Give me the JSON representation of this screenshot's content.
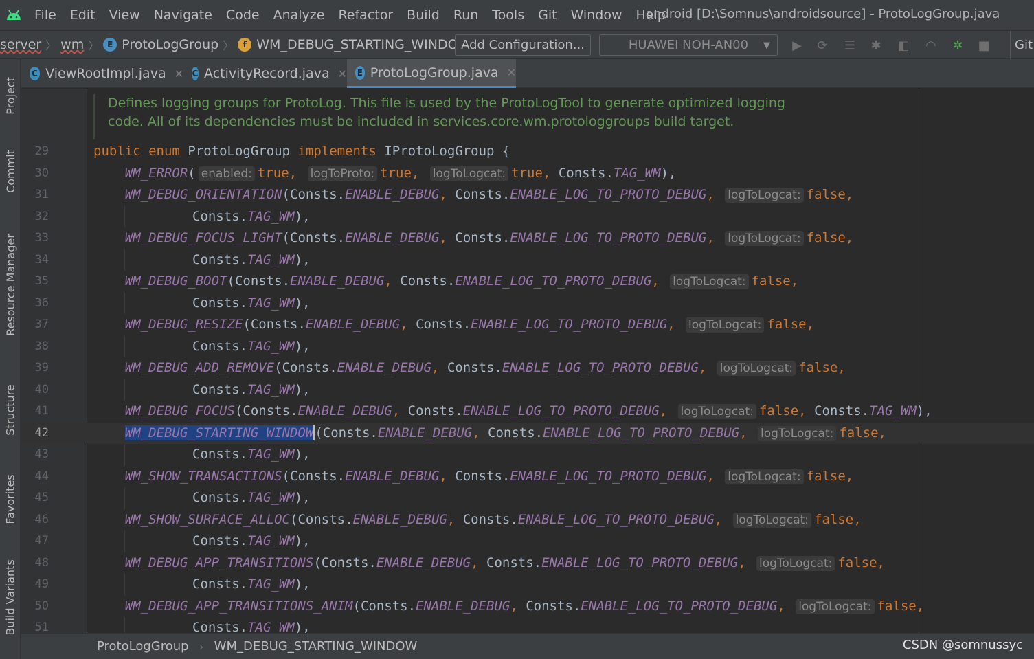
{
  "menubar": {
    "items": [
      "File",
      "Edit",
      "View",
      "Navigate",
      "Code",
      "Analyze",
      "Refactor",
      "Build",
      "Run",
      "Tools",
      "Git",
      "Window",
      "Help"
    ],
    "window_title": "android [D:\\Somnus\\androidsource] - ProtoLogGroup.java"
  },
  "navbar": {
    "crumbs": [
      "server",
      "wm",
      "ProtoLogGroup",
      "WM_DEBUG_STARTING_WINDOW"
    ],
    "add_configuration": "Add Configuration...",
    "device": "HUAWEI NOH-AN00",
    "git_label": "Git:"
  },
  "left_stripe": {
    "items": [
      "Project",
      "Commit",
      "Resource Manager",
      "Structure",
      "Favorites",
      "Build Variants"
    ]
  },
  "tabs": [
    {
      "label": "ViewRootImpl.java",
      "icon": "C",
      "active": false
    },
    {
      "label": "ActivityRecord.java",
      "icon": "C",
      "active": false
    },
    {
      "label": "ProtoLogGroup.java",
      "icon": "E",
      "active": true
    }
  ],
  "editor": {
    "doc_comment": [
      "Defines logging groups for ProtoLog. This file is used by the ProtoLogTool to generate optimized logging",
      "code. All of its dependencies must be included in services.core.wm.protologgroups build target."
    ],
    "line_numbers": [
      "29",
      "30",
      "31",
      "32",
      "33",
      "34",
      "35",
      "36",
      "37",
      "38",
      "39",
      "40",
      "41",
      "42",
      "43",
      "44",
      "45",
      "46",
      "47",
      "48",
      "49",
      "50",
      "51"
    ],
    "line29": {
      "kw1": "public",
      "kw2": "enum",
      "name": "ProtoLogGroup",
      "kw3": "implements",
      "iface": "IProtoLogGroup {"
    },
    "line30": {
      "enum": "WM_ERROR",
      "hint1": "enabled:",
      "v1": "true",
      "hint2": "logToProto:",
      "v2": "true",
      "hint3": "logToLogcat:",
      "v3": "true",
      "tail_cls": "Consts.",
      "tail_const": "TAG_WM",
      "tail_end": "),"
    },
    "common": {
      "consts": "Consts.",
      "enable_debug": "ENABLE_DEBUG",
      "enable_log": "ENABLE_LOG_TO_PROTO_DEBUG",
      "hint_logcat": "logToLogcat:",
      "false": "false",
      "tag_wm": "TAG_WM",
      "open": "(",
      "close": "),",
      "comma": ","
    },
    "enums": {
      "l31": "WM_DEBUG_ORIENTATION",
      "l33": "WM_DEBUG_FOCUS_LIGHT",
      "l35": "WM_DEBUG_BOOT",
      "l37": "WM_DEBUG_RESIZE",
      "l39": "WM_DEBUG_ADD_REMOVE",
      "l41": "WM_DEBUG_FOCUS",
      "l42": "WM_DEBUG_STARTING_WINDOW",
      "l44": "WM_SHOW_TRANSACTIONS",
      "l46": "WM_SHOW_SURFACE_ALLOC",
      "l48": "WM_DEBUG_APP_TRANSITIONS",
      "l50": "WM_DEBUG_APP_TRANSITIONS_ANIM"
    }
  },
  "statusbar": {
    "crumb1": "ProtoLogGroup",
    "crumb2": "WM_DEBUG_STARTING_WINDOW",
    "watermark": "CSDN @somnussyc"
  },
  "colors": {
    "keyword": "#cc7832",
    "enum_constant": "#9876aa",
    "doc_comment": "#629755",
    "selection": "#214283",
    "tab_underline": "#4a88c7"
  }
}
